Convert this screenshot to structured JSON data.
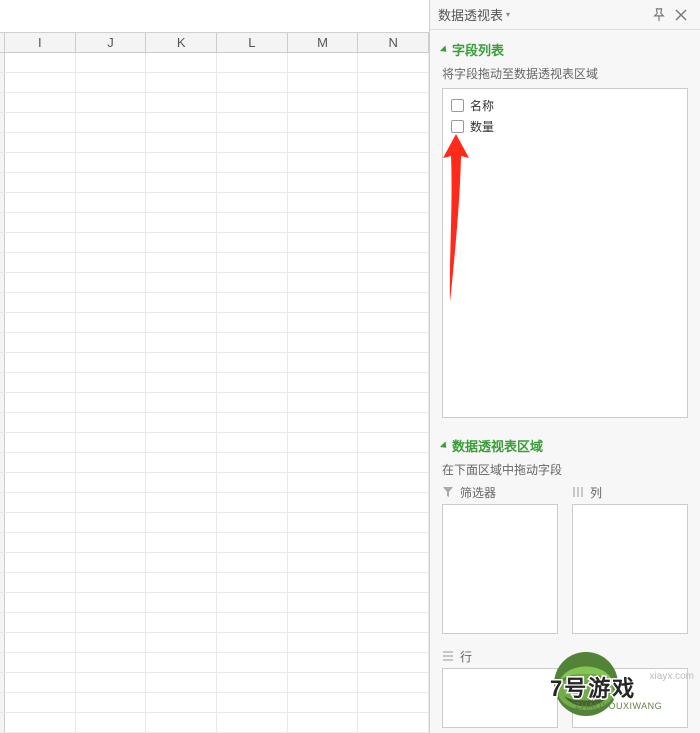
{
  "panel": {
    "title": "数据透视表",
    "section_fields_title": "字段列表",
    "section_fields_hint": "将字段拖动至数据透视表区域",
    "fields": [
      {
        "label": "名称"
      },
      {
        "label": "数量"
      }
    ],
    "section_areas_title": "数据透视表区域",
    "section_areas_hint": "在下面区域中拖动字段",
    "areas": {
      "filter": "筛选器",
      "column": "列",
      "row": "行"
    }
  },
  "columns": [
    "I",
    "J",
    "K",
    "L",
    "M",
    "N"
  ],
  "watermark": {
    "main": "7号游戏",
    "url": "xiayx.com",
    "pinyin": "ZHAOYOUXIWANG"
  }
}
